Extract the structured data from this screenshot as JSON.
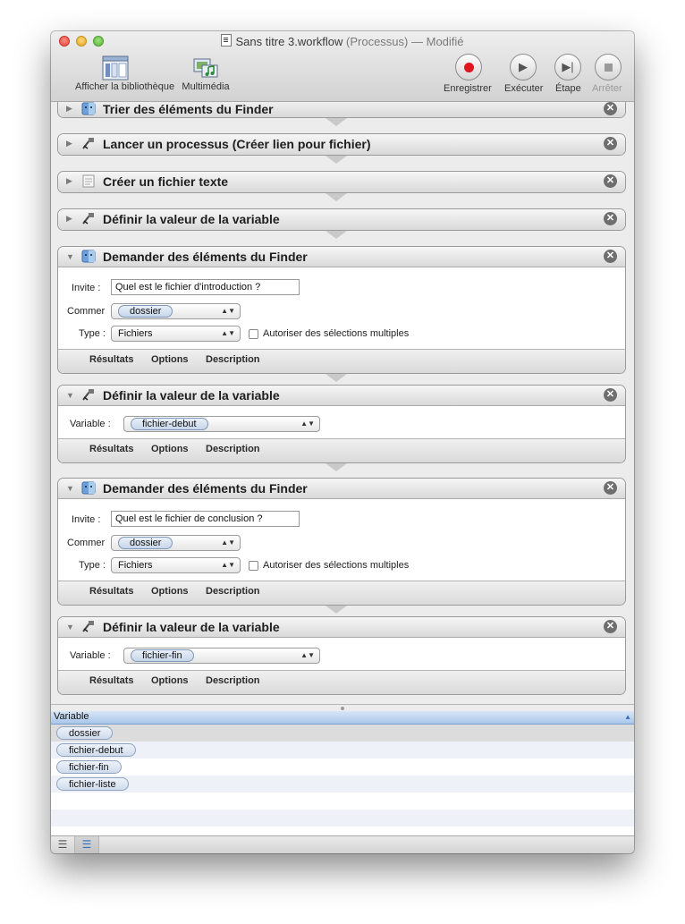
{
  "window": {
    "title_name": "Sans titre 3.workflow",
    "title_kind": "(Processus)",
    "title_status": "— Modifié"
  },
  "toolbar": {
    "library_label": "Afficher la bibliothèque",
    "media_label": "Multimédia",
    "record_label": "Enregistrer",
    "run_label": "Exécuter",
    "step_label": "Étape",
    "stop_label": "Arrêter"
  },
  "actions": [
    {
      "title": "Trier des éléments du Finder"
    },
    {
      "title": "Lancer un processus (Créer lien pour fichier)"
    },
    {
      "title": "Créer un fichier texte"
    },
    {
      "title": "Définir la valeur de la variable"
    },
    {
      "title": "Demander des éléments du Finder",
      "invite_label": "Invite :",
      "invite_value": "Quel est le fichier d'introduction ?",
      "start_label": "Commer",
      "start_token": "dossier",
      "type_label": "Type :",
      "type_value": "Fichiers",
      "multi_label": "Autoriser des sélections multiples"
    },
    {
      "title": "Définir la valeur de la variable",
      "variable_label": "Variable :",
      "variable_token": "fichier-debut"
    },
    {
      "title": "Demander des éléments du Finder",
      "invite_label": "Invite :",
      "invite_value": "Quel est le fichier de conclusion ?",
      "start_label": "Commer",
      "start_token": "dossier",
      "type_label": "Type :",
      "type_value": "Fichiers",
      "multi_label": "Autoriser des sélections multiples"
    },
    {
      "title": "Définir la valeur de la variable",
      "variable_label": "Variable :",
      "variable_token": "fichier-fin"
    }
  ],
  "footer_tabs": {
    "results": "Résultats",
    "options": "Options",
    "description": "Description"
  },
  "variables_panel": {
    "header": "Variable",
    "items": [
      "dossier",
      "fichier-debut",
      "fichier-fin",
      "fichier-liste"
    ]
  },
  "icons": {
    "close": "close-x-icon",
    "record": "record-dot-icon",
    "run": "play-icon",
    "step": "step-forward-icon",
    "stop": "stop-square-icon"
  },
  "colors": {
    "record_red": "#e0151f",
    "selection_blue": "#a8c6ea"
  }
}
